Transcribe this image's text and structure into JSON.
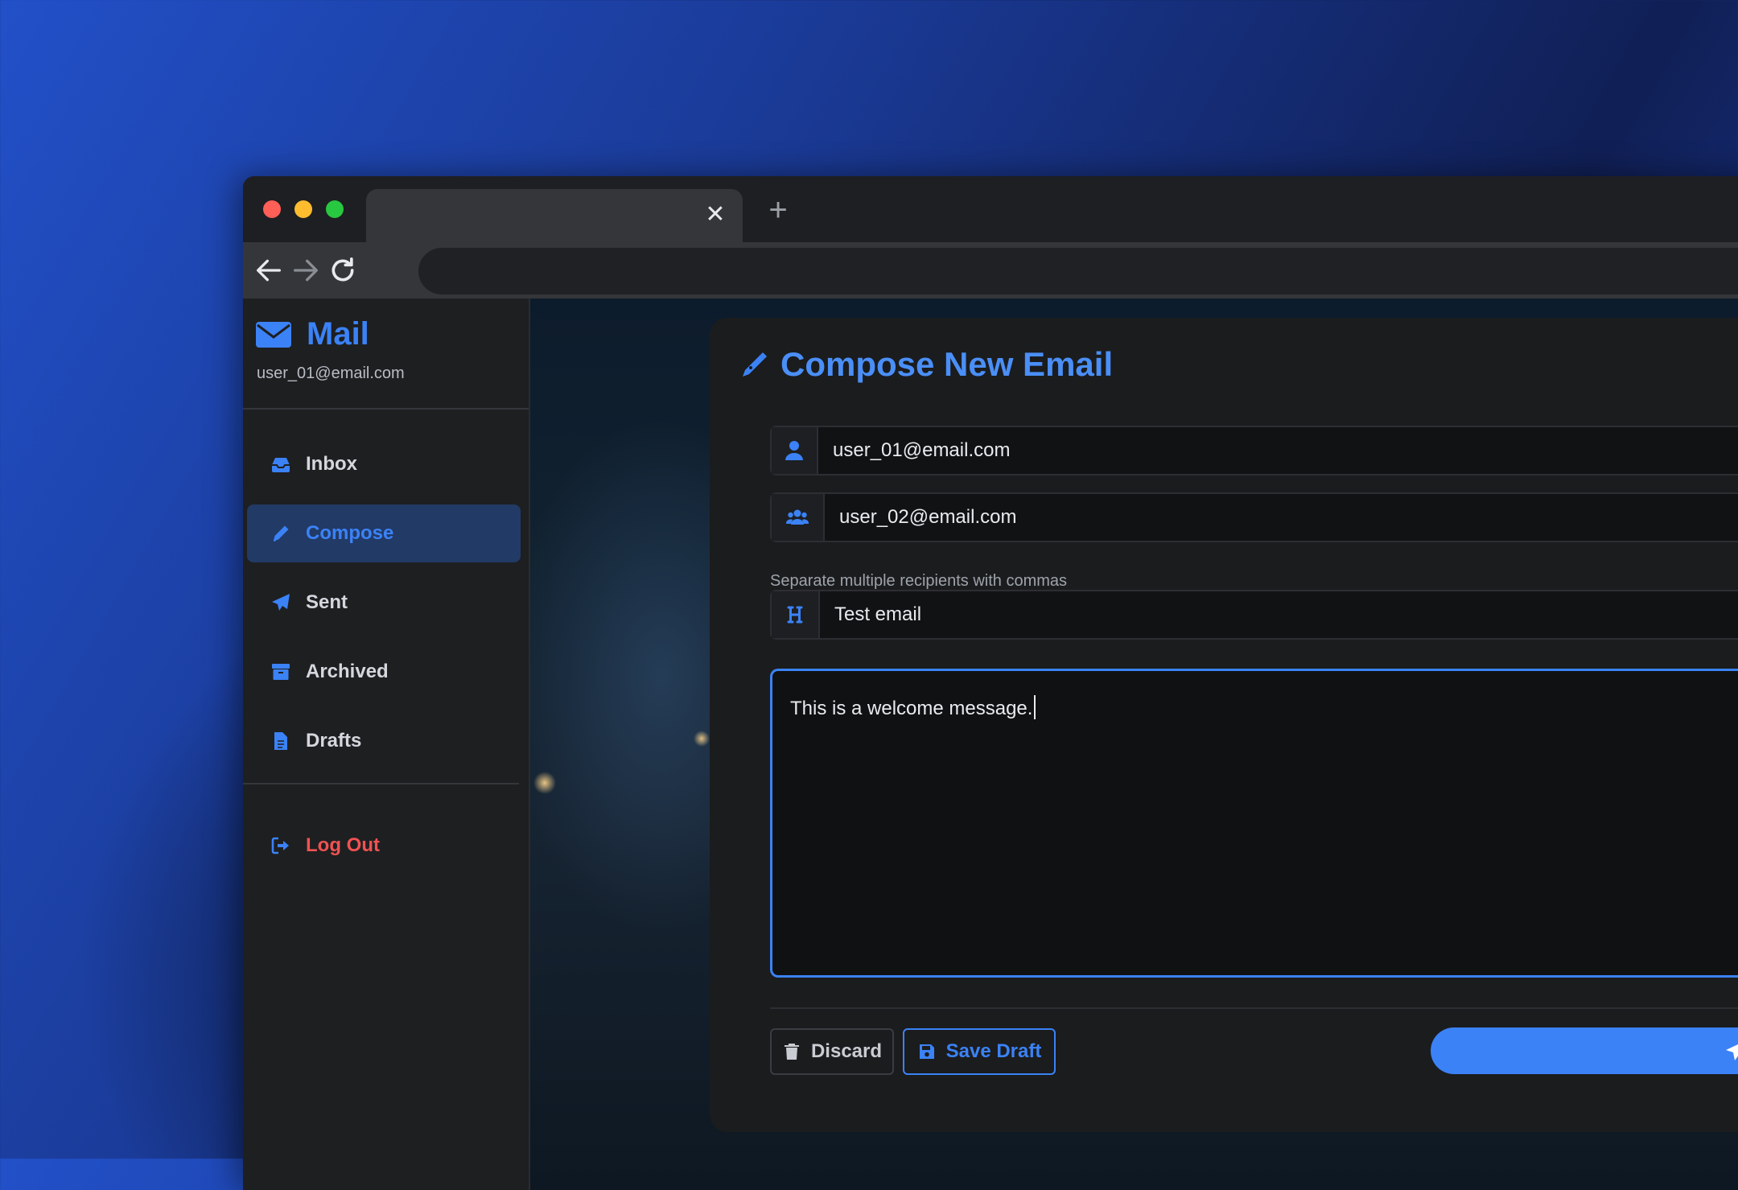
{
  "browser": {
    "tab_close_glyph": "✕",
    "new_tab_glyph": "+",
    "traffic_lights": [
      "#fe5f57",
      "#febc2e",
      "#28c840"
    ]
  },
  "sidebar": {
    "app_name": "Mail",
    "user_email": "user_01@email.com",
    "items": [
      {
        "label": "Inbox",
        "icon": "inbox-icon",
        "active": false
      },
      {
        "label": "Compose",
        "icon": "pencil-icon",
        "active": true
      },
      {
        "label": "Sent",
        "icon": "paper-plane-icon",
        "active": false
      },
      {
        "label": "Archived",
        "icon": "archive-box-icon",
        "active": false
      },
      {
        "label": "Drafts",
        "icon": "file-icon",
        "active": false
      }
    ],
    "logout": {
      "label": "Log Out",
      "icon": "sign-out-icon"
    }
  },
  "compose": {
    "title": "Compose New Email",
    "from_value": "user_01@email.com",
    "to_value": "user_02@email.com",
    "to_hint": "Separate multiple recipients with commas",
    "subject_value": "Test email",
    "body_value": "This is a welcome message.",
    "discard_label": "Discard",
    "save_draft_label": "Save Draft"
  },
  "colors": {
    "accent": "#3b82f6",
    "logout": "#f05252",
    "active_nav_bg": "#223a66"
  }
}
